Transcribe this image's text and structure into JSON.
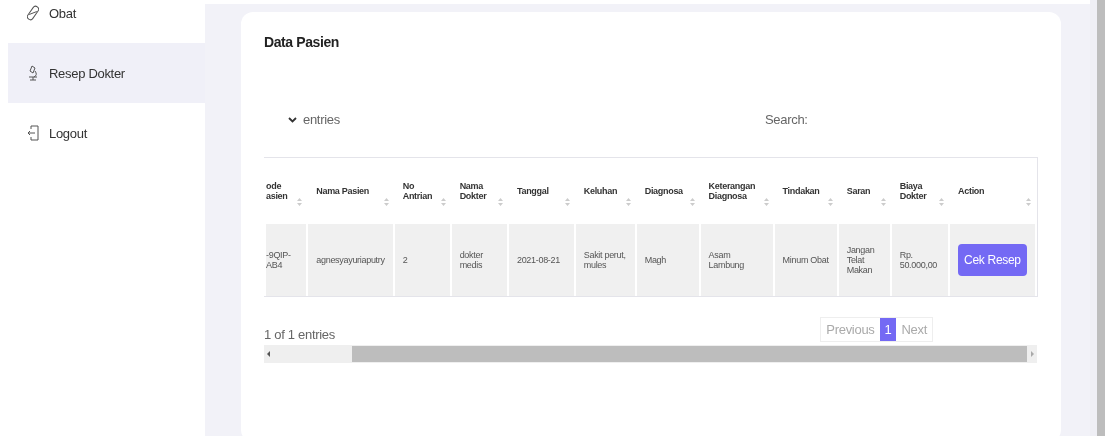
{
  "sidebar": {
    "items": [
      {
        "label": "Obat",
        "selected": false
      },
      {
        "label": "Resep Dokter",
        "selected": true
      },
      {
        "label": "Logout",
        "selected": false
      }
    ]
  },
  "card": {
    "title": "Data Pasien",
    "length_label": "entries",
    "search_label": "Search:",
    "table": {
      "columns": [
        "ode asien",
        "Nama Pasien",
        "No Antrian",
        "Nama Dokter",
        "Tanggal",
        "Keluhan",
        "Diagnosa",
        "Keterangan Diagnosa",
        "Tindakan",
        "Saran",
        "Biaya Dokter",
        "Action"
      ],
      "rows": [
        {
          "cells": [
            "-9QIP- AB4",
            "agnesyayuriaputry",
            "2",
            "dokter medis",
            "2021-08-21",
            "Sakit perut, mules",
            "Magh",
            "Asam Lambung",
            "Minum Obat",
            "Jangan Telat Makan",
            "Rp. 50.000,00"
          ],
          "action": "Cek Resep"
        }
      ]
    },
    "info": "1 of 1 entries",
    "pagination": [
      {
        "label": "Previous",
        "selected": false
      },
      {
        "label": "1",
        "selected": true
      },
      {
        "label": "Next",
        "selected": false
      }
    ]
  }
}
